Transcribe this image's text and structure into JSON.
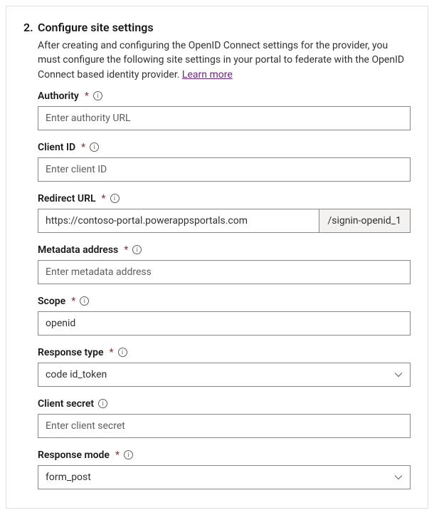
{
  "section": {
    "number": "2.",
    "title": "Configure site settings",
    "description": "After creating and configuring the OpenID Connect settings for the provider, you must configure the following site settings in your portal to federate with the OpenID Connect based identity provider.",
    "learn_more": "Learn more"
  },
  "fields": {
    "authority": {
      "label": "Authority",
      "required": true,
      "placeholder": "Enter authority URL",
      "value": ""
    },
    "client_id": {
      "label": "Client ID",
      "required": true,
      "placeholder": "Enter client ID",
      "value": ""
    },
    "redirect": {
      "label": "Redirect URL",
      "required": true,
      "value": "https://contoso-portal.powerappsportals.com",
      "suffix": "/signin-openid_1"
    },
    "metadata": {
      "label": "Metadata address",
      "required": true,
      "placeholder": "Enter metadata address",
      "value": ""
    },
    "scope": {
      "label": "Scope",
      "required": true,
      "value": "openid"
    },
    "resp_type": {
      "label": "Response type",
      "required": true,
      "value": "code id_token"
    },
    "client_sec": {
      "label": "Client secret",
      "required": false,
      "placeholder": "Enter client secret",
      "value": ""
    },
    "resp_mode": {
      "label": "Response mode",
      "required": true,
      "value": "form_post"
    }
  }
}
